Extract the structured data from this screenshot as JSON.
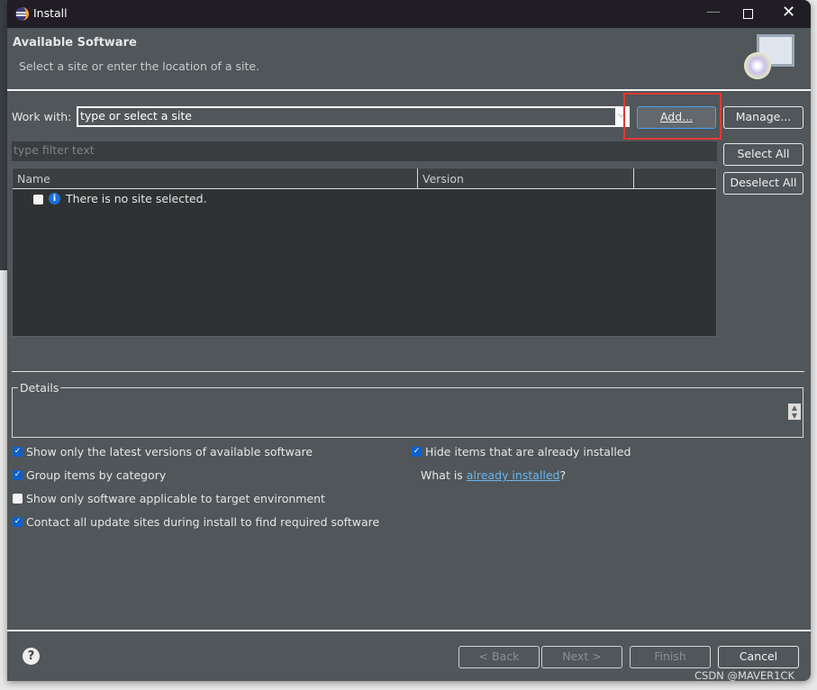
{
  "window": {
    "title": "Install"
  },
  "header": {
    "title": "Available Software",
    "subtitle": "Select a site or enter the location of a site."
  },
  "work_with": {
    "label": "Work with:",
    "placeholder": "type or select a site",
    "add": "Add...",
    "manage": "Manage..."
  },
  "filter": {
    "placeholder": "type filter text"
  },
  "table": {
    "columns": [
      "Name",
      "Version"
    ],
    "rows": [
      {
        "text": "There is no site selected.",
        "checked": false
      }
    ]
  },
  "side": {
    "select_all": "Select All",
    "deselect_all": "Deselect All"
  },
  "details": {
    "label": "Details"
  },
  "options": [
    {
      "label": "Show only the latest versions of available software",
      "checked": true
    },
    {
      "label": "Group items by category",
      "checked": true
    },
    {
      "label": "Show only software applicable to target environment",
      "checked": false
    },
    {
      "label": "Contact all update sites during install to find required software",
      "checked": true
    },
    {
      "label": "Hide items that are already installed",
      "checked": true
    }
  ],
  "installed_link": {
    "prefix": "What is ",
    "link": "already installed",
    "suffix": "?"
  },
  "footer": {
    "back": "< Back",
    "next": "Next >",
    "finish": "Finish",
    "cancel": "Cancel"
  },
  "watermark": "CSDN @MAVER1CK",
  "colors": {
    "highlight": "#e53935",
    "checkbox": "#0a60d0",
    "link": "#6ab4f0"
  }
}
